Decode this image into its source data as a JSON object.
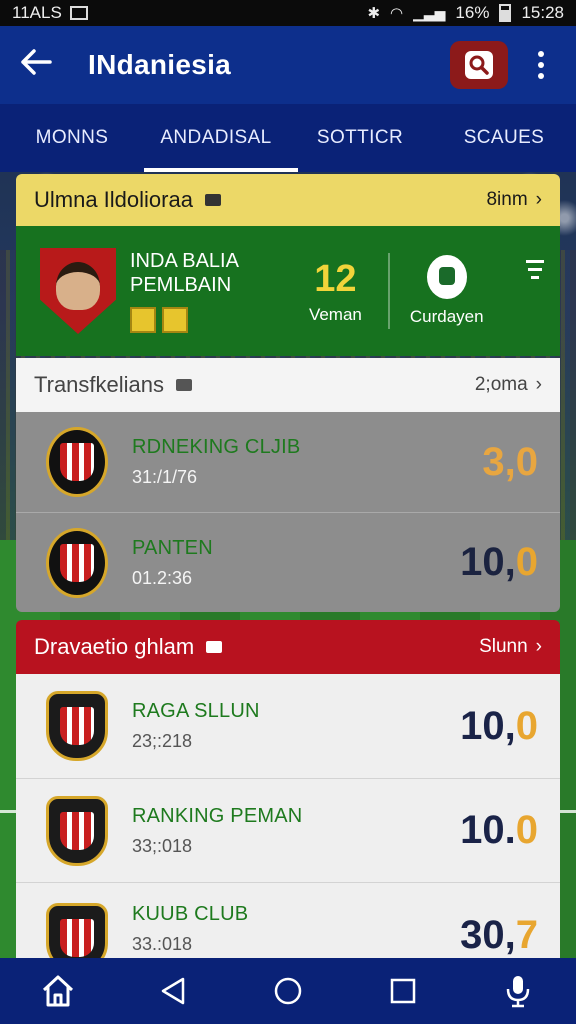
{
  "status_bar": {
    "carrier": "11ALS",
    "battery_pct": "16%",
    "time": "15:28"
  },
  "app_bar": {
    "title": "INdaniesia"
  },
  "tabs": [
    {
      "label": "MONNS",
      "active": false
    },
    {
      "label": "ANDADISAL",
      "active": true
    },
    {
      "label": "SOTTICR",
      "active": false
    },
    {
      "label": "SCAUES",
      "active": false
    }
  ],
  "featured": {
    "header_title": "Ulmna Ildolioraa",
    "header_link": "8inm",
    "player_name_line1": "INDA BALIA",
    "player_name_line2": "PEMLBAIN",
    "stat_value": "12",
    "stat_label": "Veman",
    "club_label": "Curdayen",
    "colors": {
      "header": "#ecd867",
      "body": "#17721f",
      "accent": "#f2d43a"
    }
  },
  "transfers": {
    "header_title": "Transfkelians",
    "header_link": "2;oma",
    "rows": [
      {
        "name": "RDNEKING CLJIB",
        "date": "31:/1/76",
        "score_main": "3,0",
        "score_accent": ""
      },
      {
        "name": "PANTEN",
        "date": "01.2:36",
        "score_main": "10,",
        "score_accent": "0"
      }
    ]
  },
  "rankings": {
    "header_title": "Dravaetio ghlam",
    "header_link": "Slunn",
    "rows": [
      {
        "name": "RAGA SLLUN",
        "date": "23;:218",
        "score_main": "10,",
        "score_accent": "0"
      },
      {
        "name": "RANKING PEMAN",
        "date": "33;:018",
        "score_main": "10.",
        "score_accent": "0"
      },
      {
        "name": "KUUB CLUB",
        "date": "33.:018",
        "score_main": "30,",
        "score_accent": "7"
      }
    ],
    "colors": {
      "header": "#b8121f"
    }
  },
  "icons": {
    "back": "arrow-left-icon",
    "search": "search-icon",
    "more": "more-vertical-icon",
    "home": "home-icon",
    "nav_back": "triangle-back-icon",
    "nav_home": "circle-home-icon",
    "nav_recent": "square-recents-icon",
    "mic": "microphone-icon"
  }
}
